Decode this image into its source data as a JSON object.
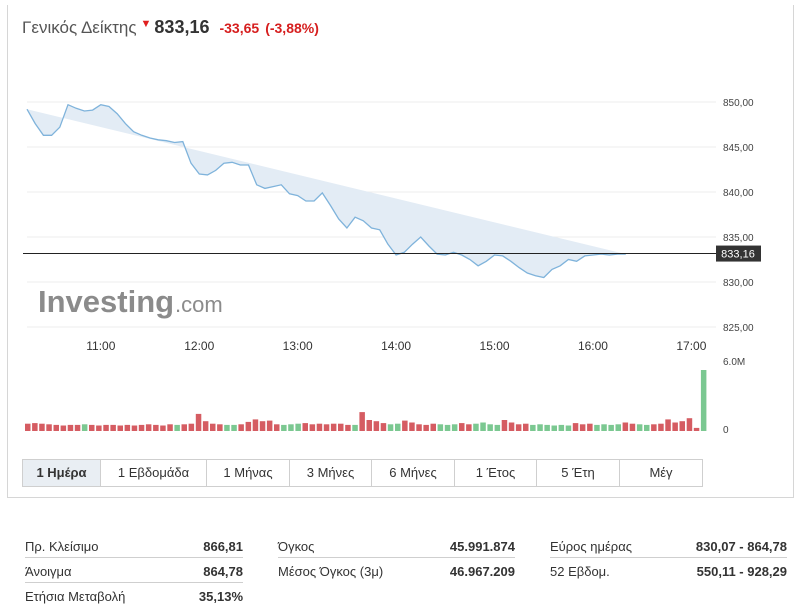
{
  "header": {
    "index_name": "Γενικός Δείκτης",
    "last": "833,16",
    "change": "-33,65",
    "change_pct": "(-3,88%)",
    "arrow_icon": "down-arrow-icon"
  },
  "watermark": {
    "brand": "Investing",
    "suffix": ".com"
  },
  "colors": {
    "line": "#7fb3db",
    "area": "#e3ecf5",
    "down": "#d55c62",
    "up": "#7bc891",
    "negative_text": "#d61e1e",
    "tab_active_bg": "#e9eef3"
  },
  "chart_data": [
    {
      "type": "area",
      "x_unit": "time",
      "x": [
        "10:15",
        "10:20",
        "10:25",
        "10:30",
        "10:35",
        "10:40",
        "10:45",
        "10:50",
        "10:55",
        "11:00",
        "11:05",
        "11:10",
        "11:15",
        "11:20",
        "11:25",
        "11:30",
        "11:35",
        "11:40",
        "11:45",
        "11:50",
        "11:55",
        "12:00",
        "12:05",
        "12:10",
        "12:15",
        "12:20",
        "12:25",
        "12:30",
        "12:35",
        "12:40",
        "12:45",
        "12:50",
        "12:55",
        "13:00",
        "13:05",
        "13:10",
        "13:15",
        "13:20",
        "13:25",
        "13:30",
        "13:35",
        "13:40",
        "13:45",
        "13:50",
        "13:55",
        "14:00",
        "14:05",
        "14:10",
        "14:15",
        "14:20",
        "14:25",
        "14:30",
        "14:35",
        "14:40",
        "14:45",
        "14:50",
        "14:55",
        "15:00",
        "15:05",
        "15:10",
        "15:15",
        "15:20",
        "15:25",
        "15:30",
        "15:35",
        "15:40",
        "15:45",
        "15:50",
        "15:55",
        "16:00",
        "16:05",
        "16:10",
        "16:15",
        "16:20",
        "16:25",
        "16:30",
        "16:35",
        "16:40",
        "16:45",
        "16:50",
        "16:55",
        "17:00",
        "17:05",
        "17:10"
      ],
      "y": [
        849.2,
        847.6,
        846.3,
        846.3,
        847.2,
        849.7,
        849.3,
        849.0,
        849.1,
        849.7,
        849.5,
        848.7,
        847.6,
        846.7,
        846.3,
        846.0,
        845.8,
        845.7,
        845.5,
        845.6,
        843.2,
        842.0,
        841.9,
        842.4,
        843.2,
        843.3,
        843.0,
        843.0,
        840.8,
        840.4,
        840.6,
        840.8,
        839.8,
        839.6,
        839.0,
        839.0,
        839.9,
        838.5,
        837.0,
        836.0,
        837.2,
        836.8,
        836.0,
        835.8,
        834.2,
        833.0,
        833.3,
        834.2,
        835.0,
        834.0,
        833.1,
        833.0,
        833.3,
        833.0,
        832.5,
        831.8,
        832.3,
        833.0,
        832.9,
        832.3,
        831.6,
        831.0,
        830.7,
        830.5,
        831.4,
        831.8,
        832.5,
        832.3,
        832.9,
        833.0,
        833.1,
        833.0,
        833.1,
        833.1
      ],
      "ylim": [
        825.0,
        855.0
      ],
      "yticks": [
        "825,00",
        "830,00",
        "835,00",
        "840,00",
        "845,00",
        "850,00"
      ],
      "xticks": [
        "11:00",
        "12:00",
        "13:00",
        "14:00",
        "15:00",
        "16:00",
        "17:00"
      ],
      "last_label": "833,16",
      "last_value": 833.16
    },
    {
      "type": "bar",
      "name": "volume",
      "ylim": [
        0,
        6000000
      ],
      "yticks": [
        "0",
        "6.0M"
      ],
      "bars": [
        {
          "v": 0.12,
          "dir": "down"
        },
        {
          "v": 0.13,
          "dir": "down"
        },
        {
          "v": 0.12,
          "dir": "down"
        },
        {
          "v": 0.11,
          "dir": "down"
        },
        {
          "v": 0.1,
          "dir": "down"
        },
        {
          "v": 0.09,
          "dir": "down"
        },
        {
          "v": 0.1,
          "dir": "down"
        },
        {
          "v": 0.1,
          "dir": "down"
        },
        {
          "v": 0.11,
          "dir": "up"
        },
        {
          "v": 0.1,
          "dir": "down"
        },
        {
          "v": 0.09,
          "dir": "down"
        },
        {
          "v": 0.1,
          "dir": "down"
        },
        {
          "v": 0.1,
          "dir": "down"
        },
        {
          "v": 0.09,
          "dir": "down"
        },
        {
          "v": 0.1,
          "dir": "down"
        },
        {
          "v": 0.09,
          "dir": "down"
        },
        {
          "v": 0.1,
          "dir": "down"
        },
        {
          "v": 0.11,
          "dir": "down"
        },
        {
          "v": 0.1,
          "dir": "down"
        },
        {
          "v": 0.09,
          "dir": "down"
        },
        {
          "v": 0.11,
          "dir": "down"
        },
        {
          "v": 0.1,
          "dir": "up"
        },
        {
          "v": 0.11,
          "dir": "down"
        },
        {
          "v": 0.12,
          "dir": "down"
        },
        {
          "v": 0.28,
          "dir": "down"
        },
        {
          "v": 0.16,
          "dir": "down"
        },
        {
          "v": 0.12,
          "dir": "down"
        },
        {
          "v": 0.11,
          "dir": "down"
        },
        {
          "v": 0.1,
          "dir": "up"
        },
        {
          "v": 0.1,
          "dir": "up"
        },
        {
          "v": 0.11,
          "dir": "down"
        },
        {
          "v": 0.15,
          "dir": "down"
        },
        {
          "v": 0.19,
          "dir": "down"
        },
        {
          "v": 0.16,
          "dir": "down"
        },
        {
          "v": 0.17,
          "dir": "down"
        },
        {
          "v": 0.11,
          "dir": "down"
        },
        {
          "v": 0.1,
          "dir": "up"
        },
        {
          "v": 0.11,
          "dir": "up"
        },
        {
          "v": 0.12,
          "dir": "up"
        },
        {
          "v": 0.13,
          "dir": "down"
        },
        {
          "v": 0.11,
          "dir": "down"
        },
        {
          "v": 0.12,
          "dir": "down"
        },
        {
          "v": 0.11,
          "dir": "down"
        },
        {
          "v": 0.12,
          "dir": "down"
        },
        {
          "v": 0.12,
          "dir": "down"
        },
        {
          "v": 0.1,
          "dir": "down"
        },
        {
          "v": 0.1,
          "dir": "up"
        },
        {
          "v": 0.31,
          "dir": "down"
        },
        {
          "v": 0.18,
          "dir": "down"
        },
        {
          "v": 0.16,
          "dir": "down"
        },
        {
          "v": 0.13,
          "dir": "down"
        },
        {
          "v": 0.11,
          "dir": "up"
        },
        {
          "v": 0.12,
          "dir": "up"
        },
        {
          "v": 0.17,
          "dir": "down"
        },
        {
          "v": 0.14,
          "dir": "down"
        },
        {
          "v": 0.11,
          "dir": "down"
        },
        {
          "v": 0.1,
          "dir": "down"
        },
        {
          "v": 0.12,
          "dir": "down"
        },
        {
          "v": 0.11,
          "dir": "up"
        },
        {
          "v": 0.1,
          "dir": "up"
        },
        {
          "v": 0.11,
          "dir": "up"
        },
        {
          "v": 0.13,
          "dir": "down"
        },
        {
          "v": 0.11,
          "dir": "down"
        },
        {
          "v": 0.12,
          "dir": "up"
        },
        {
          "v": 0.14,
          "dir": "up"
        },
        {
          "v": 0.11,
          "dir": "up"
        },
        {
          "v": 0.1,
          "dir": "up"
        },
        {
          "v": 0.18,
          "dir": "down"
        },
        {
          "v": 0.14,
          "dir": "down"
        },
        {
          "v": 0.11,
          "dir": "down"
        },
        {
          "v": 0.12,
          "dir": "down"
        },
        {
          "v": 0.1,
          "dir": "up"
        },
        {
          "v": 0.11,
          "dir": "up"
        },
        {
          "v": 0.1,
          "dir": "up"
        },
        {
          "v": 0.09,
          "dir": "up"
        },
        {
          "v": 0.1,
          "dir": "up"
        },
        {
          "v": 0.09,
          "dir": "up"
        },
        {
          "v": 0.13,
          "dir": "down"
        },
        {
          "v": 0.11,
          "dir": "down"
        },
        {
          "v": 0.12,
          "dir": "down"
        },
        {
          "v": 0.1,
          "dir": "up"
        },
        {
          "v": 0.11,
          "dir": "up"
        },
        {
          "v": 0.1,
          "dir": "up"
        },
        {
          "v": 0.11,
          "dir": "up"
        },
        {
          "v": 0.14,
          "dir": "down"
        },
        {
          "v": 0.12,
          "dir": "down"
        },
        {
          "v": 0.11,
          "dir": "up"
        },
        {
          "v": 0.1,
          "dir": "up"
        },
        {
          "v": 0.11,
          "dir": "down"
        },
        {
          "v": 0.12,
          "dir": "down"
        },
        {
          "v": 0.19,
          "dir": "down"
        },
        {
          "v": 0.14,
          "dir": "down"
        },
        {
          "v": 0.16,
          "dir": "down"
        },
        {
          "v": 0.21,
          "dir": "down"
        },
        {
          "v": 0.05,
          "dir": "down"
        },
        {
          "v": 1.0,
          "dir": "up"
        }
      ]
    }
  ],
  "tabs": [
    {
      "label": "1 Ημέρα",
      "active": true
    },
    {
      "label": "1 Εβδομάδα",
      "active": false
    },
    {
      "label": "1 Μήνας",
      "active": false
    },
    {
      "label": "3 Μήνες",
      "active": false
    },
    {
      "label": "6 Μήνες",
      "active": false
    },
    {
      "label": "1 Έτος",
      "active": false
    },
    {
      "label": "5 Έτη",
      "active": false
    },
    {
      "label": "Μέγ",
      "active": false
    }
  ],
  "stats": {
    "prev_close": {
      "label": "Πρ. Κλείσιμο",
      "value": "866,81"
    },
    "open": {
      "label": "Άνοιγμα",
      "value": "864,78"
    },
    "annual_change": {
      "label": "Ετήσια Μεταβολή",
      "value": "35,13%"
    },
    "volume": {
      "label": "Όγκος",
      "value": "45.991.874"
    },
    "avg_volume": {
      "label": "Μέσος Όγκος (3μ)",
      "value": "46.967.209"
    },
    "day_range": {
      "label": "Εύρος ημέρας",
      "value": "830,07 - 864,78"
    },
    "week52": {
      "label": "52 Εβδομ.",
      "value": "550,11 - 928,29"
    }
  }
}
